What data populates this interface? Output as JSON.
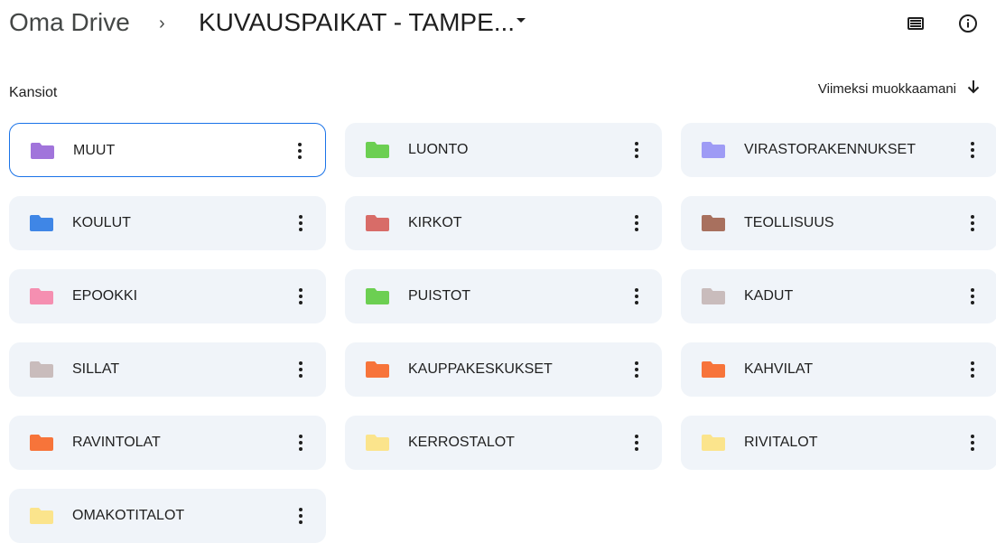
{
  "breadcrumb": {
    "root": "Oma Drive",
    "separator": "›",
    "current": "KUVAUSPAIKAT - TAMPE..."
  },
  "toolbar": {
    "list_view_icon": "list-view-icon",
    "info_icon": "info-icon"
  },
  "section": {
    "title": "Kansiot"
  },
  "sort": {
    "label": "Viimeksi muokkaamani",
    "direction_icon": "arrow-down-icon"
  },
  "folders": [
    {
      "name": "MUUT",
      "color": "#a174db",
      "selected": true
    },
    {
      "name": "LUONTO",
      "color": "#6ccf52",
      "selected": false
    },
    {
      "name": "VIRASTORAKENNUKSET",
      "color": "#9e9bf5",
      "selected": false
    },
    {
      "name": "KOULUT",
      "color": "#3f86e6",
      "selected": false
    },
    {
      "name": "KIRKOT",
      "color": "#d86c68",
      "selected": false
    },
    {
      "name": "TEOLLISUUS",
      "color": "#a8705e",
      "selected": false
    },
    {
      "name": "EPOOKKI",
      "color": "#f58fb1",
      "selected": false
    },
    {
      "name": "PUISTOT",
      "color": "#6ccf52",
      "selected": false
    },
    {
      "name": "KADUT",
      "color": "#c9bcbc",
      "selected": false
    },
    {
      "name": "SILLAT",
      "color": "#c9bcbc",
      "selected": false
    },
    {
      "name": "KAUPPAKESKUKSET",
      "color": "#f7743a",
      "selected": false
    },
    {
      "name": "KAHVILAT",
      "color": "#f7743a",
      "selected": false
    },
    {
      "name": "RAVINTOLAT",
      "color": "#f7743a",
      "selected": false
    },
    {
      "name": "KERROSTALOT",
      "color": "#fbe48c",
      "selected": false
    },
    {
      "name": "RIVITALOT",
      "color": "#fbe48c",
      "selected": false
    },
    {
      "name": "OMAKOTITALOT",
      "color": "#fbe48c",
      "selected": false
    }
  ]
}
